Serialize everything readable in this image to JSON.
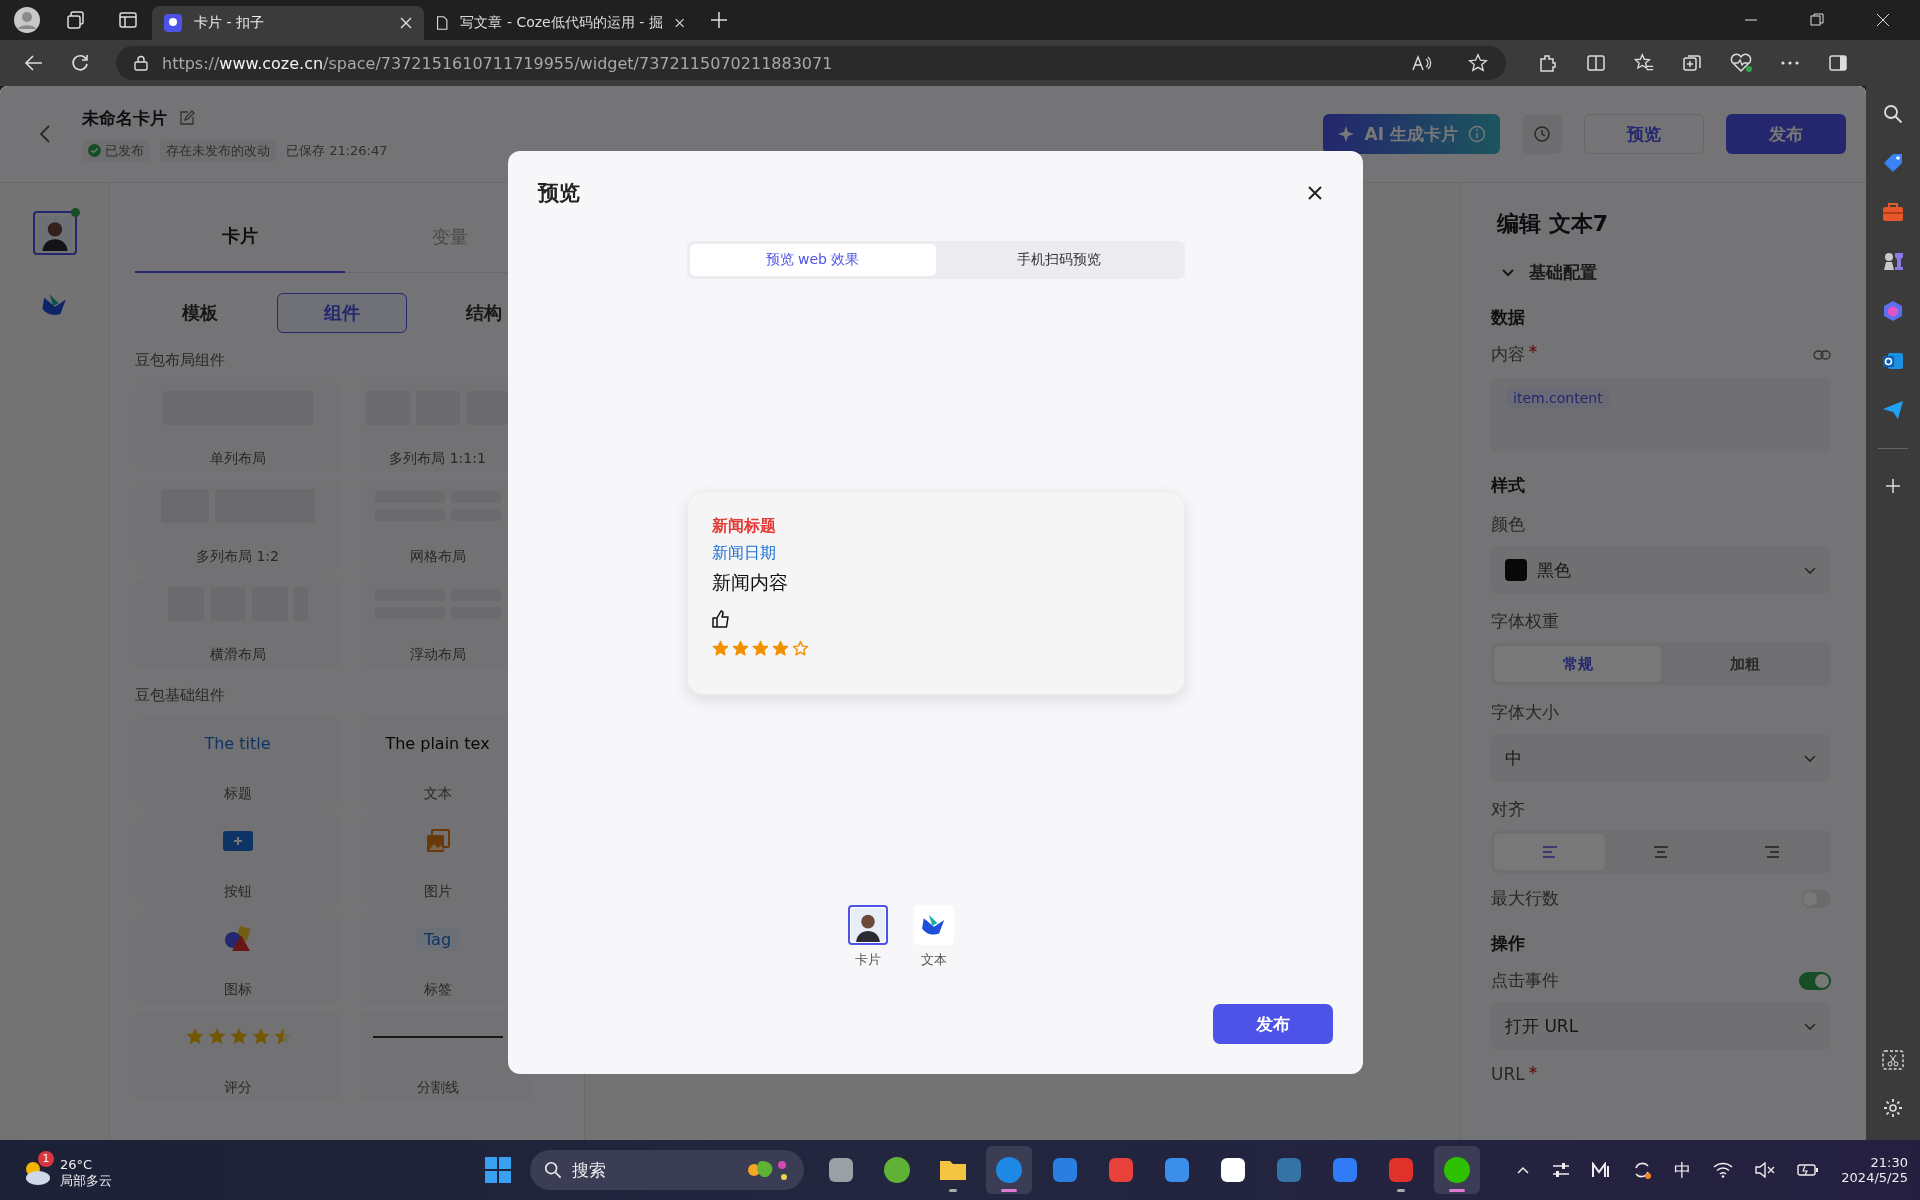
{
  "browser": {
    "tabs": [
      {
        "title": "卡片 - 扣子",
        "selected": true
      },
      {
        "title": "写文章 - Coze低代码的运用 - 掘",
        "selected": false
      }
    ],
    "url": "https://**www.coze.cn**/space/7372151610711719955/widget/7372115070211883071"
  },
  "header": {
    "title": "未命名卡片",
    "status": "已发布",
    "unpublished": "存在未发布的改动",
    "saved": "已保存 21:26:47",
    "ai_button": "AI 生成卡片",
    "preview_button": "预览",
    "publish_button": "发布"
  },
  "rail": [
    {
      "kind": "avatar",
      "selected": true,
      "online": true
    },
    {
      "kind": "logo",
      "selected": false,
      "online": false
    }
  ],
  "left_panel": {
    "tabs": [
      {
        "label": "卡片",
        "selected": true
      },
      {
        "label": "变量",
        "selected": false
      }
    ],
    "segments": [
      {
        "label": "模板",
        "selected": false
      },
      {
        "label": "组件",
        "selected": true
      },
      {
        "label": "结构",
        "selected": false
      }
    ],
    "sections": [
      {
        "title": "豆包布局组件",
        "items": [
          {
            "kind": "single",
            "label": "单列布局"
          },
          {
            "kind": "triple",
            "label": "多列布局 1:1:1"
          },
          {
            "kind": "one-two",
            "label": "多列布局 1:2"
          },
          {
            "kind": "grid",
            "label": "网格布局"
          },
          {
            "kind": "hscroll",
            "label": "横滑布局"
          },
          {
            "kind": "float",
            "label": "浮动布局"
          }
        ]
      },
      {
        "title": "豆包基础组件",
        "samples": {
          "title": "The title",
          "text": "The plain tex",
          "tag": "Tag"
        },
        "items": [
          {
            "kind": "title",
            "label": "标题"
          },
          {
            "kind": "text",
            "label": "文本"
          },
          {
            "kind": "button",
            "label": "按钮"
          },
          {
            "kind": "image",
            "label": "图片"
          },
          {
            "kind": "icon",
            "label": "图标"
          },
          {
            "kind": "tag",
            "label": "标签"
          },
          {
            "kind": "rating",
            "label": "评分"
          },
          {
            "kind": "divider",
            "label": "分割线"
          }
        ]
      }
    ]
  },
  "modal": {
    "title": "预览",
    "tabs": [
      {
        "label": "预览 web 效果",
        "selected": true
      },
      {
        "label": "手机扫码预览",
        "selected": false
      }
    ],
    "card": {
      "title": "新闻标题",
      "date": "新闻日期",
      "content": "新闻内容",
      "stars": 4
    },
    "nodes": [
      {
        "kind": "avatar",
        "label": "卡片",
        "selected": true
      },
      {
        "kind": "logo",
        "label": "文本",
        "selected": false
      }
    ],
    "publish_button": "发布"
  },
  "right_panel": {
    "title": "编辑 文本7",
    "section": "基础配置",
    "expanded": true,
    "data_heading": "数据",
    "content_label": "内容",
    "content_required": true,
    "content_value": "item.content",
    "style_heading": "样式",
    "color_label": "颜色",
    "color_value": "黑色",
    "weight_label": "字体权重",
    "weights": [
      {
        "label": "常规",
        "selected": true
      },
      {
        "label": "加粗",
        "selected": false
      }
    ],
    "size_label": "字体大小",
    "size_value": "中",
    "align_label": "对齐",
    "aligns": [
      {
        "kind": "left",
        "selected": true
      },
      {
        "kind": "center",
        "selected": false
      },
      {
        "kind": "right",
        "selected": false
      }
    ],
    "maxlines_label": "最大行数",
    "maxlines_on": false,
    "action_heading": "操作",
    "click_label": "点击事件",
    "click_on": true,
    "action_value": "打开 URL",
    "url_label": "URL",
    "url_required": true
  },
  "taskbar": {
    "weather_temp": "26°C",
    "weather_desc": "局部多云",
    "weather_badge": "1",
    "search_placeholder": "搜索",
    "apps": [
      {
        "kind": "multitask",
        "running": false,
        "selected": false
      },
      {
        "kind": "frog",
        "running": false,
        "selected": false
      },
      {
        "kind": "folder",
        "running": true,
        "selected": false
      },
      {
        "kind": "edge",
        "running": true,
        "selected": true
      },
      {
        "kind": "store",
        "running": false,
        "selected": false
      },
      {
        "kind": "huawei",
        "running": false,
        "selected": false
      },
      {
        "kind": "cloud",
        "running": false,
        "selected": false
      },
      {
        "kind": "m",
        "running": false,
        "selected": false
      },
      {
        "kind": "python",
        "running": false,
        "selected": false
      },
      {
        "kind": "feishu",
        "running": false,
        "selected": false
      },
      {
        "kind": "wps",
        "running": true,
        "selected": false
      },
      {
        "kind": "wechat",
        "running": true,
        "selected": true
      }
    ],
    "ime": "中",
    "time": "21:30",
    "date": "2024/5/25"
  }
}
